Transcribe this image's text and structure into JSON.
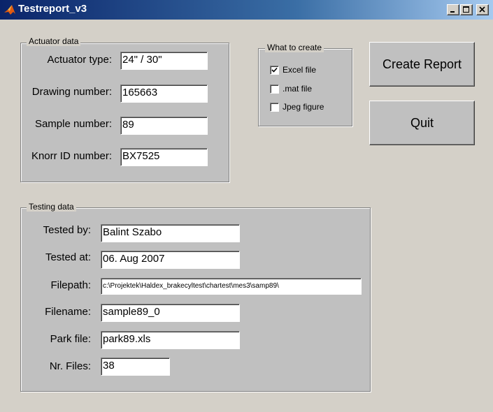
{
  "window": {
    "title": "Testreport_v3",
    "icon": "matlab-icon",
    "controls": [
      "minimize-icon",
      "maximize-icon",
      "close-icon"
    ]
  },
  "actuator": {
    "title": "Actuator data",
    "fields": [
      {
        "label": "Actuator type:",
        "value": "24\" / 30\""
      },
      {
        "label": "Drawing number:",
        "value": "165663"
      },
      {
        "label": "Sample number:",
        "value": "89"
      },
      {
        "label": "Knorr ID number:",
        "value": "BX7525"
      }
    ]
  },
  "create": {
    "title": "What to create",
    "options": [
      {
        "label": "Excel file",
        "checked": true
      },
      {
        "label": ".mat file",
        "checked": false
      },
      {
        "label": "Jpeg figure",
        "checked": false
      }
    ]
  },
  "buttons": {
    "create_report": "Create Report",
    "quit": "Quit"
  },
  "testing": {
    "title": "Testing data",
    "fields": [
      {
        "label": "Tested by:",
        "value": "Balint Szabo"
      },
      {
        "label": "Tested at:",
        "value": "06. Aug 2007"
      },
      {
        "label": "Filepath:",
        "value": "c:\\Projektek\\Haldex_brakecyltest\\chartest\\mes3\\samp89\\"
      },
      {
        "label": "Filename:",
        "value": "sample89_0"
      },
      {
        "label": "Park file:",
        "value": "park89.xls"
      },
      {
        "label": "Nr. Files:",
        "value": "38"
      }
    ]
  }
}
